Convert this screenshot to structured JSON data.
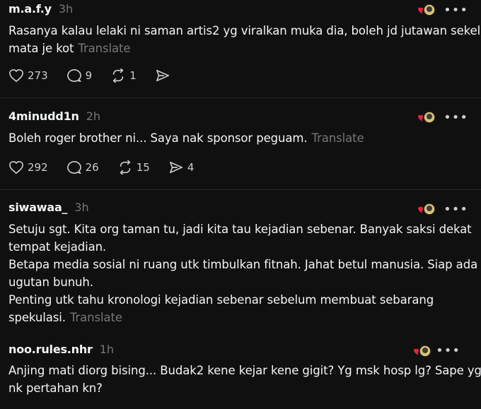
{
  "posts": [
    {
      "username": "m.a.f.y",
      "time": "3h",
      "lines": [
        "Rasanya kalau lelaki ni saman artis2 yg viralkan muka dia, boleh jd jutawan sekelip",
        "mata je kot"
      ],
      "translate": "Translate",
      "likes": "273",
      "replies": "9",
      "reposts": "1",
      "shares": ""
    },
    {
      "username": "4minudd1n",
      "time": "2h",
      "lines": [
        "Boleh roger brother ni... Saya nak sponsor peguam."
      ],
      "translate": "Translate",
      "likes": "292",
      "replies": "26",
      "reposts": "15",
      "shares": "4"
    },
    {
      "username": "siwawaa_",
      "time": "3h",
      "lines": [
        "Setuju sgt. Kita org taman tu, jadi kita tau kejadian sebenar. Banyak saksi dekat",
        "tempat kejadian.",
        "Betapa media sosial ni ruang utk timbulkan fitnah. Jahat betul manusia. Siap ada",
        "ugutan bunuh.",
        "Penting utk tahu kronologi kejadian sebenar sebelum membuat sebarang",
        "spekulasi."
      ],
      "translate": "Translate"
    },
    {
      "username": "noo.rules.nhr",
      "time": "1h",
      "lines": [
        "Anjing mati diorg bising... Budak2 kene kejar kene gigit? Yg msk hosp lg? Sape yg",
        "nk pertahan kn?"
      ]
    }
  ],
  "more_glyph": "•••",
  "colors": {
    "background": "#101010",
    "text": "#f3f5f7",
    "muted": "#777777",
    "heart": "#e5243f"
  }
}
